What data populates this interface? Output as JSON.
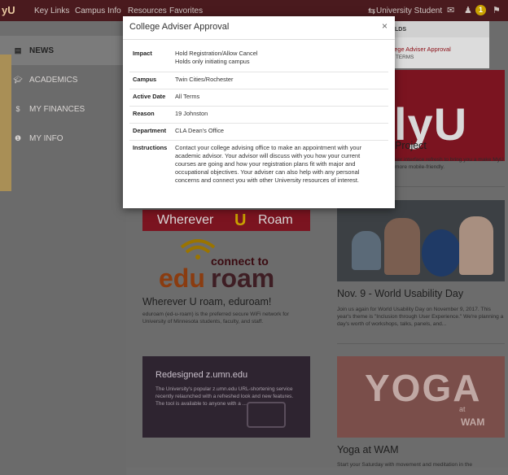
{
  "topbar": {
    "logo": "yU",
    "nav": [
      "Key Links",
      "Campus Info",
      "Resources",
      "Favorites"
    ],
    "user": "University Student",
    "alert_count": "1"
  },
  "sidebar": {
    "items": [
      {
        "icon": "news-icon",
        "label": "NEWS"
      },
      {
        "icon": "academics-icon",
        "label": "ACADEMICS"
      },
      {
        "icon": "finances-icon",
        "label": "MY FINANCES"
      },
      {
        "icon": "info-icon",
        "label": "MY INFO"
      }
    ]
  },
  "dropdown": {
    "header": "LDS",
    "link": "llege Adviser Approval",
    "sub": "TERMS"
  },
  "cards": {
    "myu_project": {
      "banner_text": "lyU",
      "title": "Project",
      "text": "ser interface refresh to bring you a make MyU more mobile-friendly."
    },
    "eduroam": {
      "banner_top_left": "Wherever",
      "banner_top_u": "U",
      "banner_top_right": "Roam",
      "connect_to": "connect to",
      "logo_edu": "edu",
      "logo_roam": "roam",
      "title": "Wherever U roam, eduroam!",
      "text": "eduroam (ed-u-roam) is the preferred secure WiFi network for University of Minnesota students, faculty, and staff."
    },
    "usability": {
      "title": "Nov. 9 - World Usability Day",
      "text": "Join us again for World Usability Day on November 9, 2017. This year's theme is \"Inclusion through User Experience.\" We're planning a day's worth of workshops, talks, panels, and..."
    },
    "zumn": {
      "heading": "Redesigned z.umn.edu",
      "text": "The University's popular z.umn.edu URL-shortening service recently relaunched with a refreshed look and new features. The tool is available to anyone with a ..."
    },
    "yoga": {
      "banner_big": "YOGA",
      "banner_at": "at",
      "banner_wam": "WAM",
      "title": "Yoga at WAM",
      "text": "Start your Saturday with movement and meditation in the"
    }
  },
  "modal": {
    "title": "College Adviser Approval",
    "close": "×",
    "rows": [
      {
        "label": "Impact",
        "value": "Hold Registration/Allow Cancel",
        "value2": "Holds only initiating campus"
      },
      {
        "label": "Campus",
        "value": "Twin Cities/Rochester"
      },
      {
        "label": "Active Date",
        "value": "All Terms"
      },
      {
        "label": "Reason",
        "value": "19 Johnston"
      },
      {
        "label": "Department",
        "value": "CLA Dean's Office"
      },
      {
        "label": "Instructions",
        "value": "Contact your college advising office to make an appointment with your academic advisor. Your advisor will discuss with you how your current courses are going and how your registration plans fit with major and occupational objectives. Your adviser can also help with any personal concerns and connect you with other University resources of interest."
      }
    ]
  },
  "colors": {
    "maroon": "#7a0019",
    "gold": "#ffcc33",
    "eduroam_orange": "#e56a1e"
  }
}
